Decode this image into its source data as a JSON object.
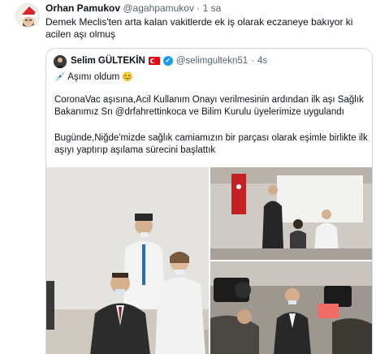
{
  "tweet": {
    "author_name": "Orhan Pamukov",
    "author_handle": "@agahpamukov",
    "separator": "·",
    "time": "1 sa",
    "text": "Demek Meclis'ten arta kalan vakitlerde ek iş olarak eczaneye bakıyor ki acilen aşı olmuş"
  },
  "quoted_tweet": {
    "author_name": "Selim GÜLTEKİN",
    "author_handle": "@selimgultekn51",
    "separator": "·",
    "time": "4s",
    "line1": "Aşımı oldum",
    "line2": "CoronaVac aşısına,Acil Kullanım Onayı verilmesinin ardından ilk aşı Sağlık Bakanımız Sn @drfahrettinkoca ve Bilim Kurulu üyelerimize uygulandı",
    "line3": "Bugünde,Niğde'mizde sağlık camiamızın bir parçası olarak eşimle birlikte ilk aşıyı yaptırıp aşılama sürecini başlattık",
    "emoji_syringe": "💉",
    "emoji_smile": "😊"
  },
  "icons": {
    "avatar": "santa-hat-avatar-icon",
    "flag": "turkey-flag-icon",
    "verified": "verified-badge-icon"
  },
  "colors": {
    "muted": "#536471",
    "border": "#cfd9de",
    "verified": "#1d9bf0",
    "flag": "#e30a17"
  }
}
